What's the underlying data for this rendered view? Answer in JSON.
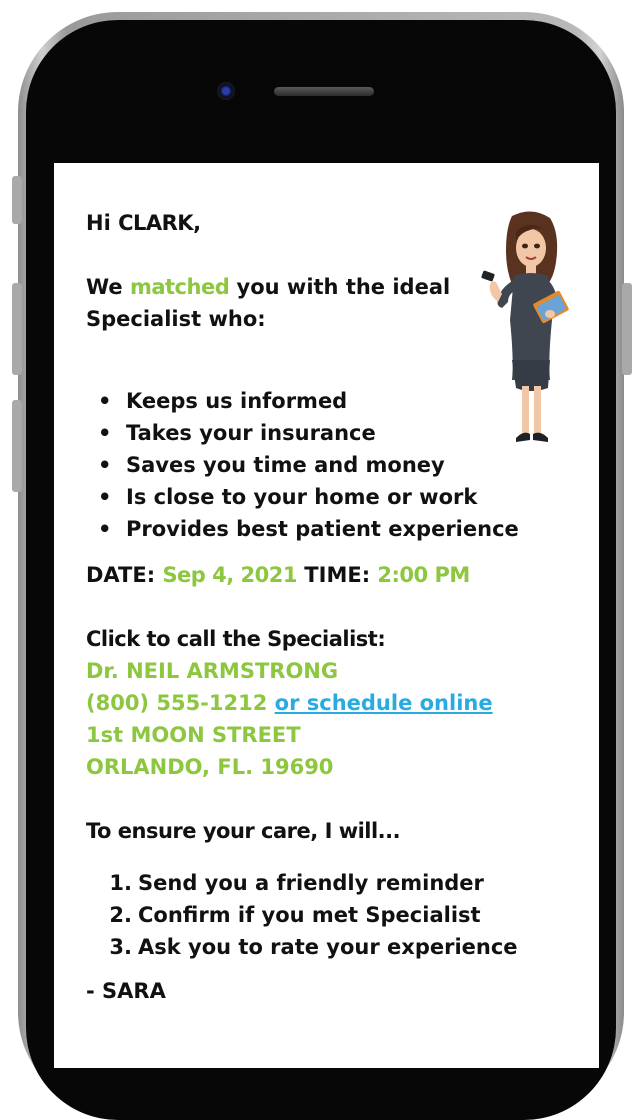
{
  "greeting": {
    "prefix": "Hi ",
    "name": "CLARK",
    "suffix": ","
  },
  "intro": {
    "part1": "We ",
    "highlight": "matched",
    "part2": " you with the ideal",
    "line2": "Specialist who:"
  },
  "bullets": [
    "Keeps us informed",
    "Takes your insurance",
    "Saves you time and money",
    "Is close to your home or work",
    "Provides best patient experience"
  ],
  "appointment": {
    "date_label": "DATE: ",
    "date_value": "Sep 4, 2021",
    "time_label": " TIME: ",
    "time_value": "2:00 PM"
  },
  "specialist": {
    "heading": "Click to call the Specialist:",
    "name": "Dr. NEIL ARMSTRONG",
    "phone": "(800) 555-1212",
    "schedule_link": "or schedule online",
    "street": "1st MOON STREET",
    "city": "ORLANDO, FL. 19690"
  },
  "care": {
    "heading": "To ensure your care, I will...",
    "steps": [
      {
        "num": "1.",
        "text": "Send you a friendly reminder"
      },
      {
        "num": "2.",
        "text": "Confirm if you met Specialist"
      },
      {
        "num": "3.",
        "text": "Ask you to rate your experience"
      }
    ]
  },
  "signature": "- SARA",
  "avatar_icon": "assistant-woman-illustration",
  "colors": {
    "accent_green": "#8dc63f",
    "link_blue": "#29abe2",
    "text": "#111111"
  }
}
